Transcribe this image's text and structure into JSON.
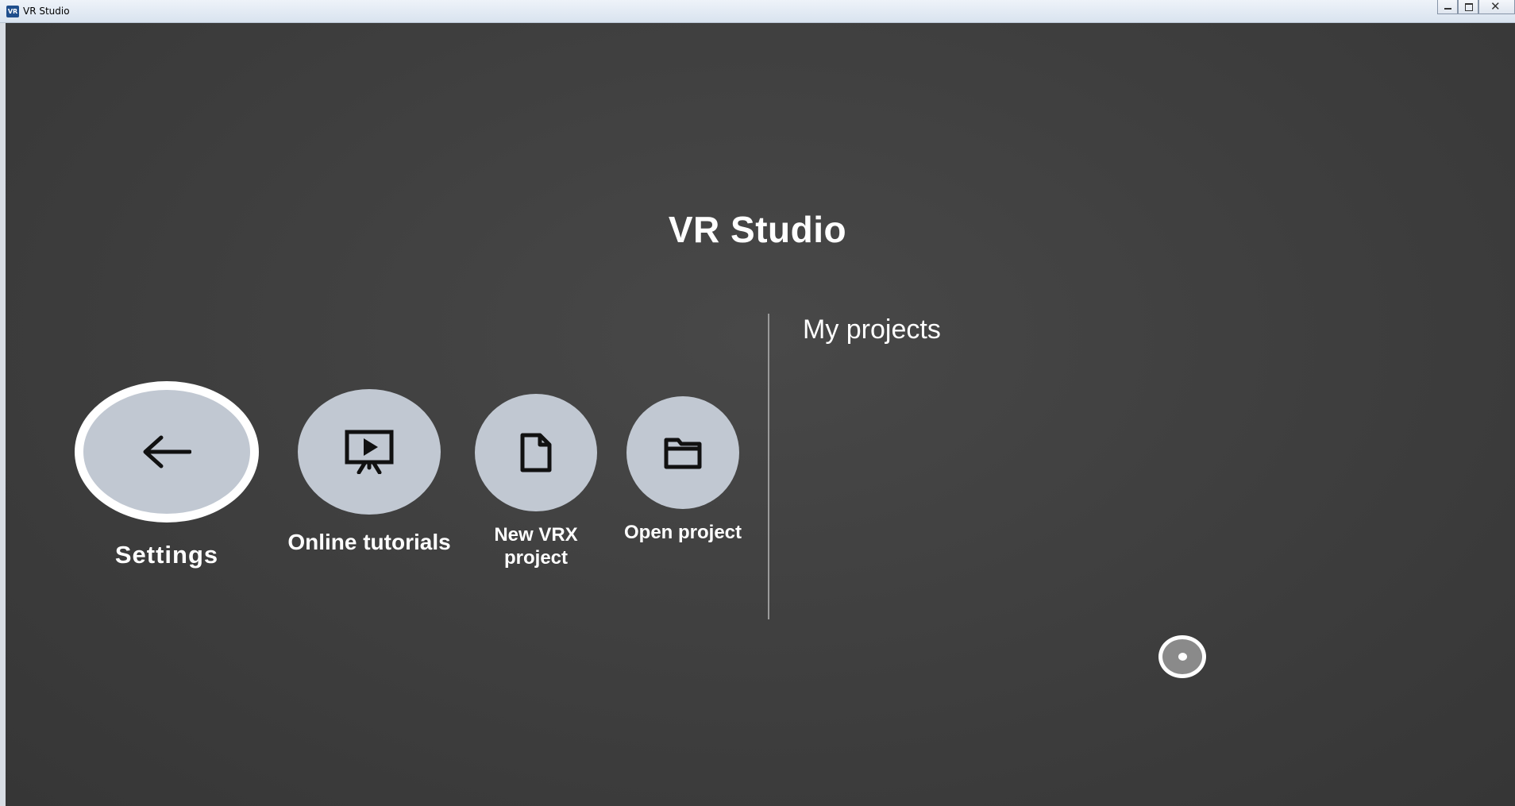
{
  "window": {
    "title": "VR Studio",
    "icon_text": "VR",
    "controls": {
      "minimize_icon": "minimize-icon",
      "maximize_icon": "maximize-icon",
      "close_glyph": "✕"
    }
  },
  "main": {
    "title": "VR Studio",
    "actions": [
      {
        "label": "Settings",
        "icon": "back-arrow-icon"
      },
      {
        "label": "Online tutorials",
        "icon": "presentation-play-icon"
      },
      {
        "label": "New VRX\nproject",
        "icon": "new-file-icon"
      },
      {
        "label": "Open project",
        "icon": "folder-icon"
      }
    ]
  },
  "projects": {
    "heading": "My projects",
    "items": []
  },
  "colors": {
    "background": "#3d3d3d",
    "button_fill": "#c1c8d2",
    "text": "#ffffff",
    "highlight_ring": "#ffffff"
  }
}
